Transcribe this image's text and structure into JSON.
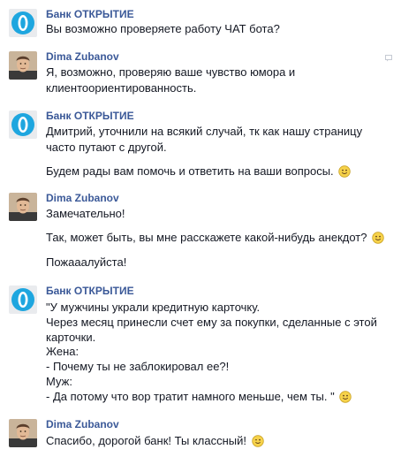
{
  "bank_name": "Банк ОТКРЫТИЕ",
  "user_name": "Dima Zubanov",
  "messages": [
    {
      "author": "Банк ОТКРЫТИЕ",
      "lines": [
        "Вы возможно проверяете работу ЧАТ бота?"
      ]
    },
    {
      "author": "Dima Zubanov",
      "lines": [
        "Я, возможно, проверяю ваше чувство юмора и",
        "клиентоориентированность."
      ]
    },
    {
      "author": "Банк ОТКРЫТИЕ",
      "lines": [
        "Дмитрий, уточнили на всякий случай, тк как нашу страницу",
        "часто путают с другой.",
        "Будем рады вам помочь и ответить на ваши вопросы."
      ]
    },
    {
      "author": "Dima Zubanov",
      "lines": [
        "Замечательно!",
        "Так, может быть, вы мне расскажете какой-нибудь анекдот?",
        "Пожааалуйста!"
      ]
    },
    {
      "author": "Банк ОТКРЫТИЕ",
      "lines": [
        "\"У мужчины украли кредитную карточку.",
        "Через месяц принесли счет ему за покупки, сделанные с этой",
        "карточки.",
        "Жена:",
        "- Почему ты не заблокировал ее?!",
        "Муж:",
        "- Да потому что вор тратит намного меньше, чем ты. \""
      ]
    },
    {
      "author": "Dima Zubanov",
      "lines": [
        "Спасибо, дорогой банк! Ты классный!"
      ]
    }
  ],
  "icons": {
    "bank_avatar": "bank-logo-icon",
    "user_avatar": "user-photo-icon",
    "smile": "smile-emoticon-icon",
    "wink": "wink-emoticon-icon",
    "report": "message-corner-icon"
  },
  "colors": {
    "author": "#3b5998",
    "text": "#141823",
    "bank_logo": "#1ea6df",
    "emoticon": "#f6d24a"
  }
}
